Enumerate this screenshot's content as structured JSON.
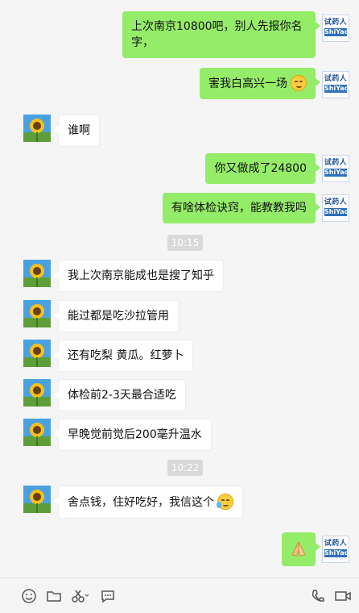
{
  "brand": {
    "line1": "试药人",
    "line2": "ShiYao8"
  },
  "messages": [
    {
      "side": "mine",
      "text": "上次南京10800吧，别人先报你名字，"
    },
    {
      "side": "mine",
      "text": "害我白高兴一场",
      "emoji": "grin-emoji"
    },
    {
      "side": "theirs",
      "text": "谁啊"
    },
    {
      "side": "mine",
      "text": "你又做成了24800"
    },
    {
      "side": "mine",
      "text": "有啥体检诀窍，能教教我吗"
    },
    {
      "time": "10:15"
    },
    {
      "side": "theirs",
      "text": "我上次南京能成也是搜了知乎"
    },
    {
      "side": "theirs",
      "text": "能过都是吃沙拉管用"
    },
    {
      "side": "theirs",
      "text": "还有吃梨 黄瓜。红萝卜"
    },
    {
      "side": "theirs",
      "text": "体检前2-3天最合适吃"
    },
    {
      "side": "theirs",
      "text": "早晚觉前觉后200毫升温水"
    },
    {
      "time": "10:22"
    },
    {
      "side": "theirs",
      "text": "舍点钱，住好吃好，我信这个",
      "emoji": "laugh-cry-emoji"
    },
    {
      "side": "mine",
      "text": "",
      "emoji": "pray-hands-emoji"
    }
  ],
  "toolbar": {
    "icons": [
      "smiley-icon",
      "folder-icon",
      "scissors-icon",
      "chat-bubble-icon",
      "phone-icon",
      "video-icon"
    ]
  }
}
